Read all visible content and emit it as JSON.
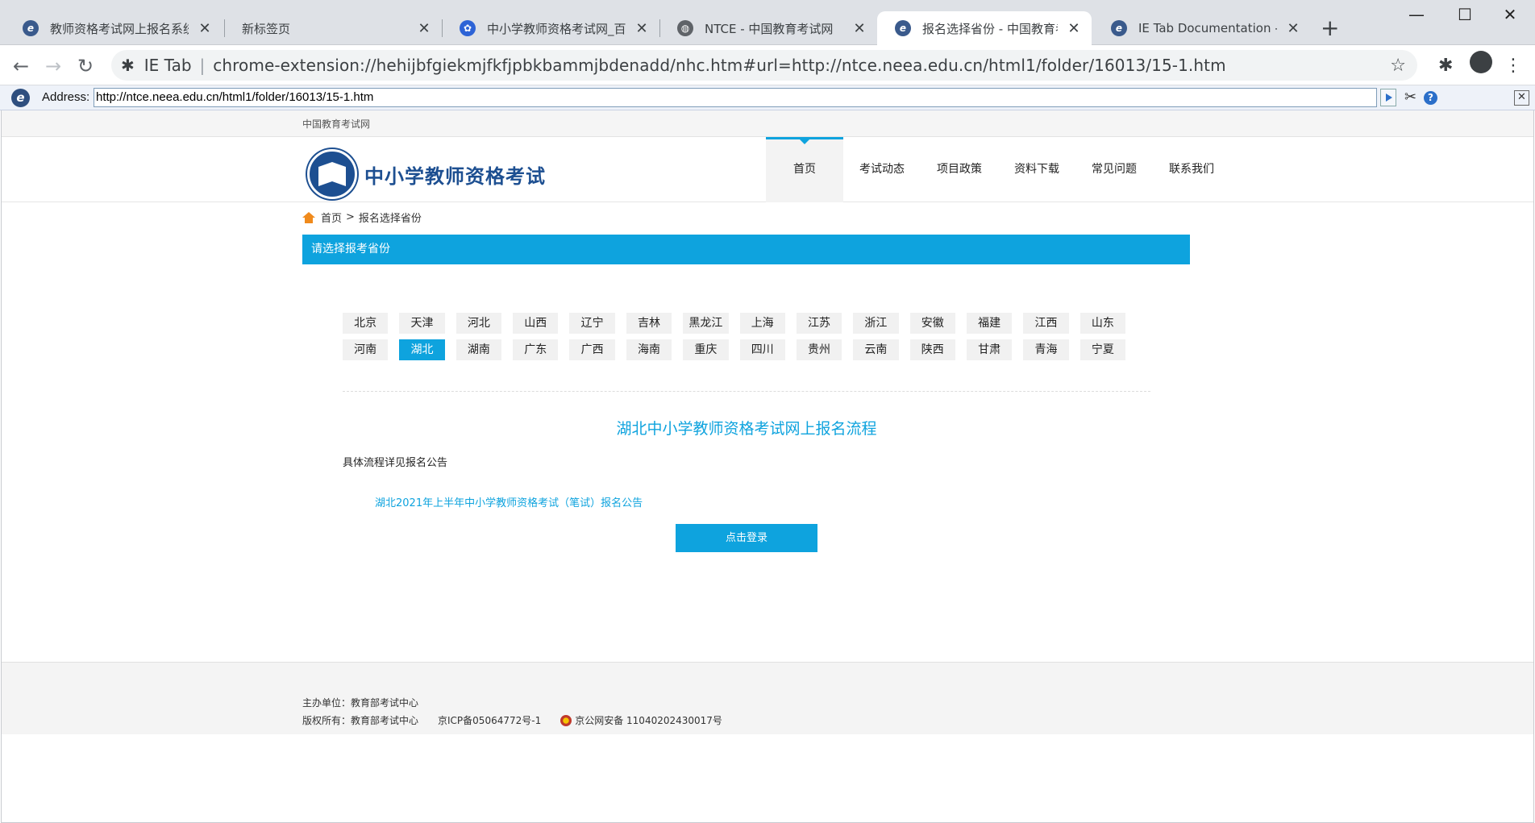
{
  "tabs": [
    {
      "title": "教师资格考试网上报名系统",
      "icon": "ie-icon",
      "active": false
    },
    {
      "title": "新标签页",
      "icon": "",
      "active": false
    },
    {
      "title": "中小学教师资格考试网_百度",
      "icon": "baidu-icon",
      "active": false
    },
    {
      "title": "NTCE - 中国教育考试网",
      "icon": "globe-icon",
      "active": false
    },
    {
      "title": "报名选择省份 - 中国教育考试",
      "icon": "ie-icon",
      "active": true
    },
    {
      "title": "IE Tab Documentation - IE",
      "icon": "ie-icon",
      "active": false
    }
  ],
  "omnibox": {
    "extension": "IE Tab",
    "url": "chrome-extension://hehijbfgiekmjfkfjpbkbammjbdenadd/nhc.htm#url=http://ntce.neea.edu.cn/html1/folder/16013/15-1.htm"
  },
  "iebar": {
    "label": "Address:",
    "address": "http://ntce.neea.edu.cn/html1/folder/16013/15-1.htm"
  },
  "site": {
    "top_strip": "中国教育考试网",
    "title": "中小学教师资格考试",
    "nav": [
      "首页",
      "考试动态",
      "项目政策",
      "资料下载",
      "常见问题",
      "联系我们"
    ],
    "nav_active_index": 0
  },
  "breadcrumb": {
    "home": "首页",
    "separator": ">",
    "current": "报名选择省份"
  },
  "banner": "请选择报考省份",
  "provinces": {
    "row1": [
      "北京",
      "天津",
      "河北",
      "山西",
      "辽宁",
      "吉林",
      "黑龙江",
      "上海",
      "江苏",
      "浙江",
      "安徽",
      "福建",
      "江西",
      "山东"
    ],
    "row2": [
      "河南",
      "湖北",
      "湖南",
      "广东",
      "广西",
      "海南",
      "重庆",
      "四川",
      "贵州",
      "云南",
      "陕西",
      "甘肃",
      "青海",
      "宁夏"
    ],
    "selected": "湖北"
  },
  "flow": {
    "title": "湖北中小学教师资格考试网上报名流程",
    "desc": "具体流程详见报名公告",
    "announcement": "湖北2021年上半年中小学教师资格考试（笔试）报名公告",
    "login": "点击登录"
  },
  "footer": {
    "sponsor": "主办单位：教育部考试中心",
    "copyright": "版权所有：教育部考试中心",
    "icp": "京ICP备05064772号-1",
    "police": "京公网安备 11040202430017号"
  },
  "colors": {
    "accent": "#0ea3de",
    "brand": "#1d4f91"
  }
}
